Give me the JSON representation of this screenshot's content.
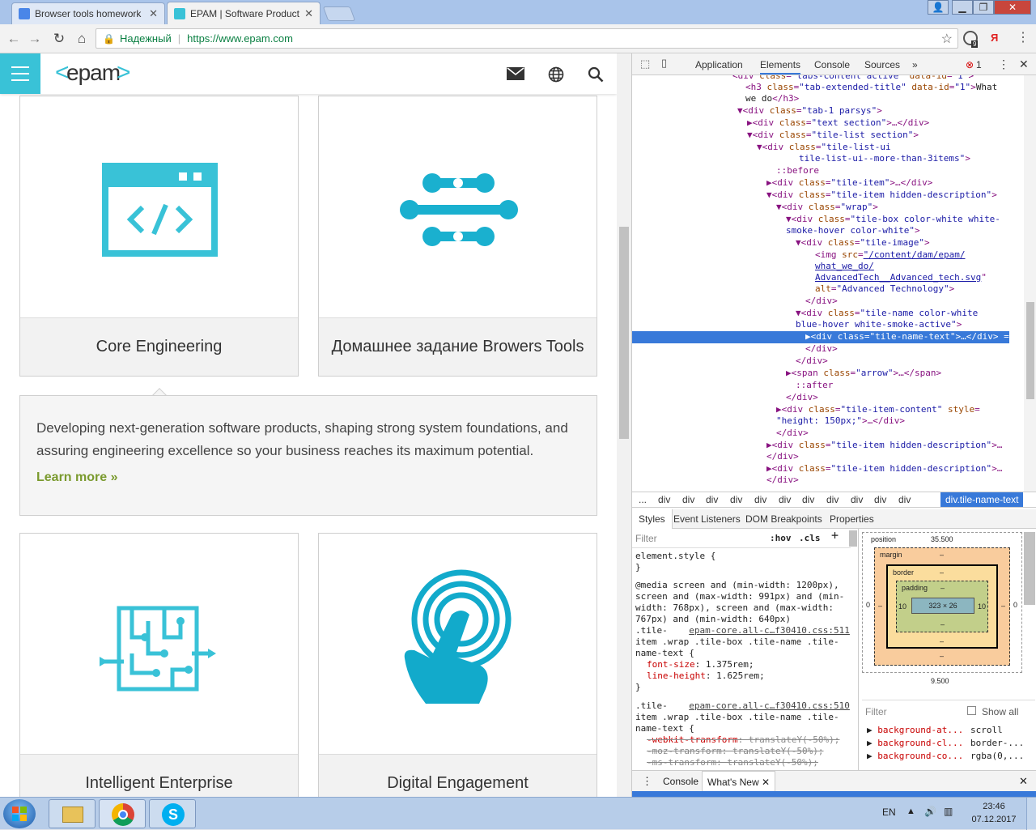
{
  "browser": {
    "tabs": [
      {
        "title": "Browser tools homework",
        "favicon_color": "#4a86e8"
      },
      {
        "title": "EPAM | Software Product",
        "favicon_color": "#39c2d7"
      }
    ],
    "secure_label": "Надежный",
    "url": "https://www.epam.com",
    "ext_badge": "9"
  },
  "site": {
    "logo_text": "epam",
    "accent": "#39c2d7",
    "tiles_row1": [
      {
        "title": "Core Engineering",
        "icon": "code-window-icon"
      },
      {
        "title": "Домашнее задание Browers Tools",
        "icon": "advanced-tech-icon"
      }
    ],
    "description": "Developing next-generation software products, shaping strong system foundations, and assuring engineering excellence so your business reaches its maximum potential.",
    "learn_more": "Learn more »",
    "tiles_row2": [
      {
        "title": "Intelligent Enterprise",
        "icon": "circuit-maze-icon"
      },
      {
        "title": "Digital Engagement",
        "icon": "touch-hand-icon"
      }
    ]
  },
  "devtools": {
    "tabs": [
      "Application",
      "Elements",
      "Console",
      "Sources",
      "»"
    ],
    "active_tab": "Elements",
    "error_count": "1",
    "breadcrumbs": [
      "...",
      "div",
      "div",
      "div",
      "div",
      "div",
      "div",
      "div",
      "div",
      "div",
      "div",
      "div",
      "div.tile-name-text"
    ],
    "styles_tabs": [
      "Styles",
      "Event Listeners",
      "DOM Breakpoints",
      "Properties"
    ],
    "filter_placeholder": "Filter",
    "hov": ":hov",
    "cls": ".cls",
    "box_model": {
      "position": "position",
      "position_value": "35.500",
      "margin": "margin",
      "border": "border",
      "padding": "padding",
      "content": "323 × 26",
      "pad_left": "10",
      "pad_right": "10",
      "dash": "–",
      "zero": "0",
      "bottom_value": "9.500"
    },
    "computed_filter": "Filter",
    "show_all": "Show all",
    "computed": [
      {
        "name": "background-at...",
        "value": "scroll"
      },
      {
        "name": "background-cl...",
        "value": "border-..."
      },
      {
        "name": "background-co...",
        "value": "rgba(0,..."
      }
    ],
    "drawer_tabs": [
      "Console",
      "What's New"
    ]
  },
  "taskbar": {
    "lang": "EN",
    "time": "23:46",
    "date": "07.12.2017"
  }
}
